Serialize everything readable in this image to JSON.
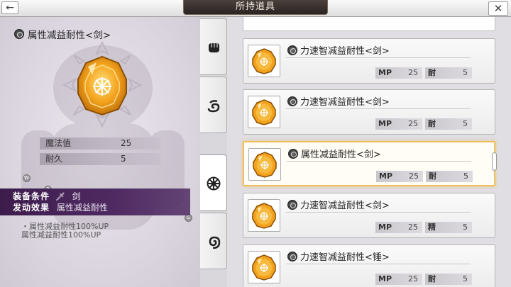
{
  "header": {
    "title": "所持道具",
    "back_symbol": "←",
    "close_symbol": "✕"
  },
  "detail": {
    "item_name": "属性减益耐性<剑>",
    "stats": [
      {
        "label": "魔法值",
        "value": "25"
      },
      {
        "label": "耐久",
        "value": "5"
      }
    ],
    "equip_condition_label": "装备条件",
    "equip_condition_value": "剑",
    "effect_label": "发动效果",
    "effect_value": "属性减益耐性",
    "desc_line1": "・属性减益耐性100%UP",
    "desc_line2": "属性减益耐性100%UP",
    "markers": [
      "W",
      "B",
      "S"
    ]
  },
  "tabs": [
    {
      "name": "fist-icon"
    },
    {
      "name": "swirl-icon"
    },
    {
      "name": "compass-icon",
      "active": true
    },
    {
      "name": "spiral-icon"
    }
  ],
  "list": [
    {
      "name": "力速智减益耐性<剑>",
      "stat1_label": "MP",
      "stat1_value": "25",
      "stat2_label": "耐",
      "stat2_value": "5"
    },
    {
      "name": "力速智减益耐性<剑>",
      "stat1_label": "MP",
      "stat1_value": "25",
      "stat2_label": "耐",
      "stat2_value": "5"
    },
    {
      "name": "属性减益耐性<剑>",
      "stat1_label": "MP",
      "stat1_value": "25",
      "stat2_label": "耐",
      "stat2_value": "5",
      "selected": true
    },
    {
      "name": "力速智减益耐性<剑>",
      "stat1_label": "MP",
      "stat1_value": "25",
      "stat2_label": "精",
      "stat2_value": "5"
    },
    {
      "name": "力速智减益耐性<锤>",
      "stat1_label": "MP",
      "stat1_value": "25",
      "stat2_label": "耐",
      "stat2_value": "5"
    }
  ],
  "colors": {
    "gem_orange": "#f3a21c",
    "selected_border": "#f0c060",
    "equip_bg": "#4a2560"
  }
}
